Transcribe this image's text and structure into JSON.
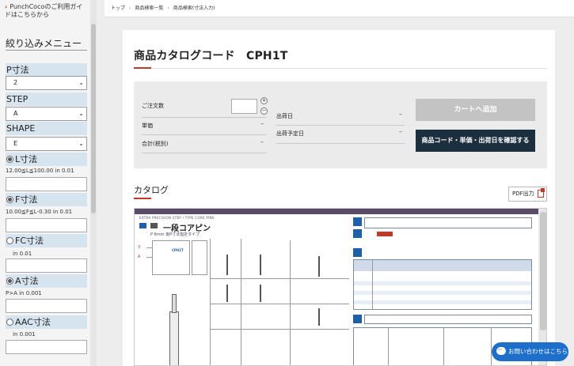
{
  "sidebar": {
    "guide_link": "PunchCocoのご利用ガイドはこちらから",
    "menu_title": "絞り込みメニュー",
    "filters": {
      "p": {
        "label": "P寸法",
        "value": "2"
      },
      "step": {
        "label": "STEP",
        "value": "A"
      },
      "shape": {
        "label": "SHAPE",
        "value": "E"
      },
      "l": {
        "label": "L寸法",
        "range": "12.00≦L≦100.00 in 0.01",
        "checked": true
      },
      "f": {
        "label": "F寸法",
        "range": "10.00≦F≦L-0.30 in 0.01",
        "checked": true
      },
      "fc": {
        "label": "FC寸法",
        "range": "in 0.01",
        "checked": false
      },
      "a": {
        "label": "A寸法",
        "range": "P>A in 0.001",
        "checked": true
      },
      "aac": {
        "label": "AAC寸法",
        "range": "in 0.001",
        "checked": false
      }
    }
  },
  "breadcrumb": [
    "トップ",
    "商品検索一覧",
    "商品検索(寸法入力)"
  ],
  "product": {
    "title": "商品カタログコード　CPH1T"
  },
  "order": {
    "qty_label": "ご注文数",
    "unit_price_label": "単価",
    "unit_price_value": "–",
    "total_label": "合計(税別)",
    "total_value": "–",
    "ship_date_label": "出荷日",
    "ship_date_value": "–",
    "ship_plan_label": "出荷予定日",
    "ship_plan_value": "–",
    "plus": "+",
    "minus": "−",
    "add_cart": "カートへ追加",
    "check_button": "商品コード・単価・出荷日を確認する"
  },
  "catalog": {
    "title": "カタログ",
    "pdf_label": "PDF出力",
    "header_text": "EXTRA PRECISION STEP / TYPE CORE PINS",
    "heading": "一段コアピン",
    "subheading": "P 6mm 後P寸法指定タイプ",
    "marker_3": "3",
    "marker_a": "A",
    "code": "CPH1T"
  },
  "chat": {
    "label": "お問い合わせはこちら"
  },
  "colors": {
    "accent": "#c0392b",
    "navy": "#1c2f3f",
    "filter_head": "#d6e4ef",
    "chat": "#1e6fc9"
  }
}
